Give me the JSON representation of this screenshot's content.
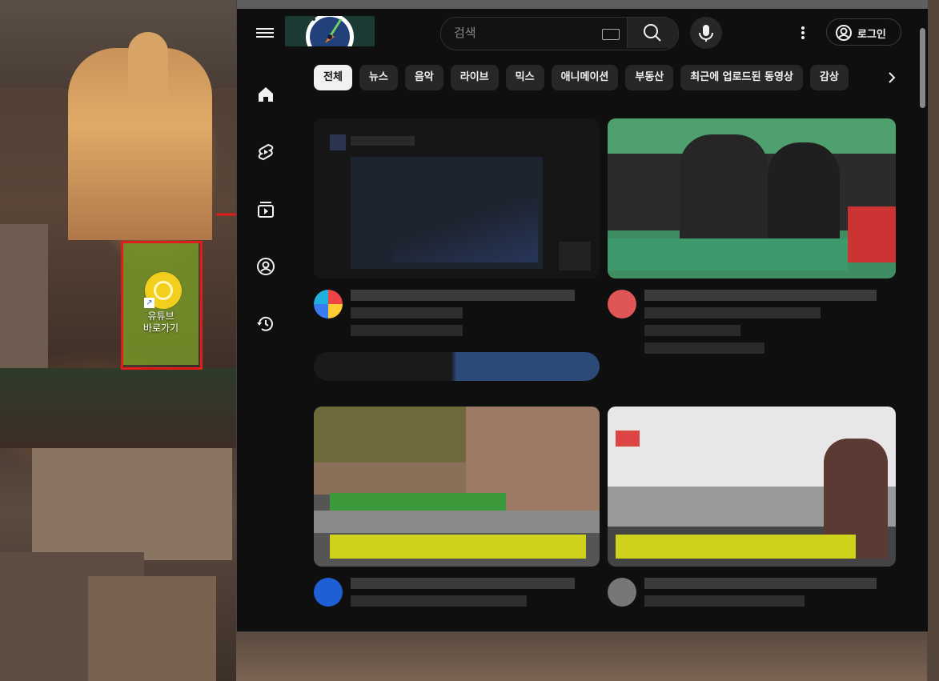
{
  "desktop": {
    "shortcut": {
      "label": "유튜브\n바로가기"
    }
  },
  "browser": {
    "search": {
      "placeholder": "검색"
    },
    "login": {
      "label": "로그인"
    },
    "chips": [
      "전체",
      "뉴스",
      "음악",
      "라이브",
      "믹스",
      "애니메이션",
      "부동산",
      "최근에 업로드된 동영상",
      "감상"
    ],
    "active_chip": "전체"
  },
  "icons": {
    "menu": "hamburger-menu-icon",
    "search": "search-icon",
    "mic": "microphone-icon",
    "more": "more-vert-icon",
    "account": "account-circle-icon",
    "home": "home-icon",
    "shorts": "shorts-icon",
    "subscriptions": "subscriptions-icon",
    "you": "you-icon",
    "history": "history-icon",
    "chevron": "chevron-right-icon"
  },
  "colors": {
    "background": "#0f0f0f",
    "chip": "#272727",
    "chip_active": "#f1f1f1",
    "text": "#f1f1f1",
    "highlight_frame": "#e21b1b",
    "annotation_arrow": "#e21b1b"
  }
}
